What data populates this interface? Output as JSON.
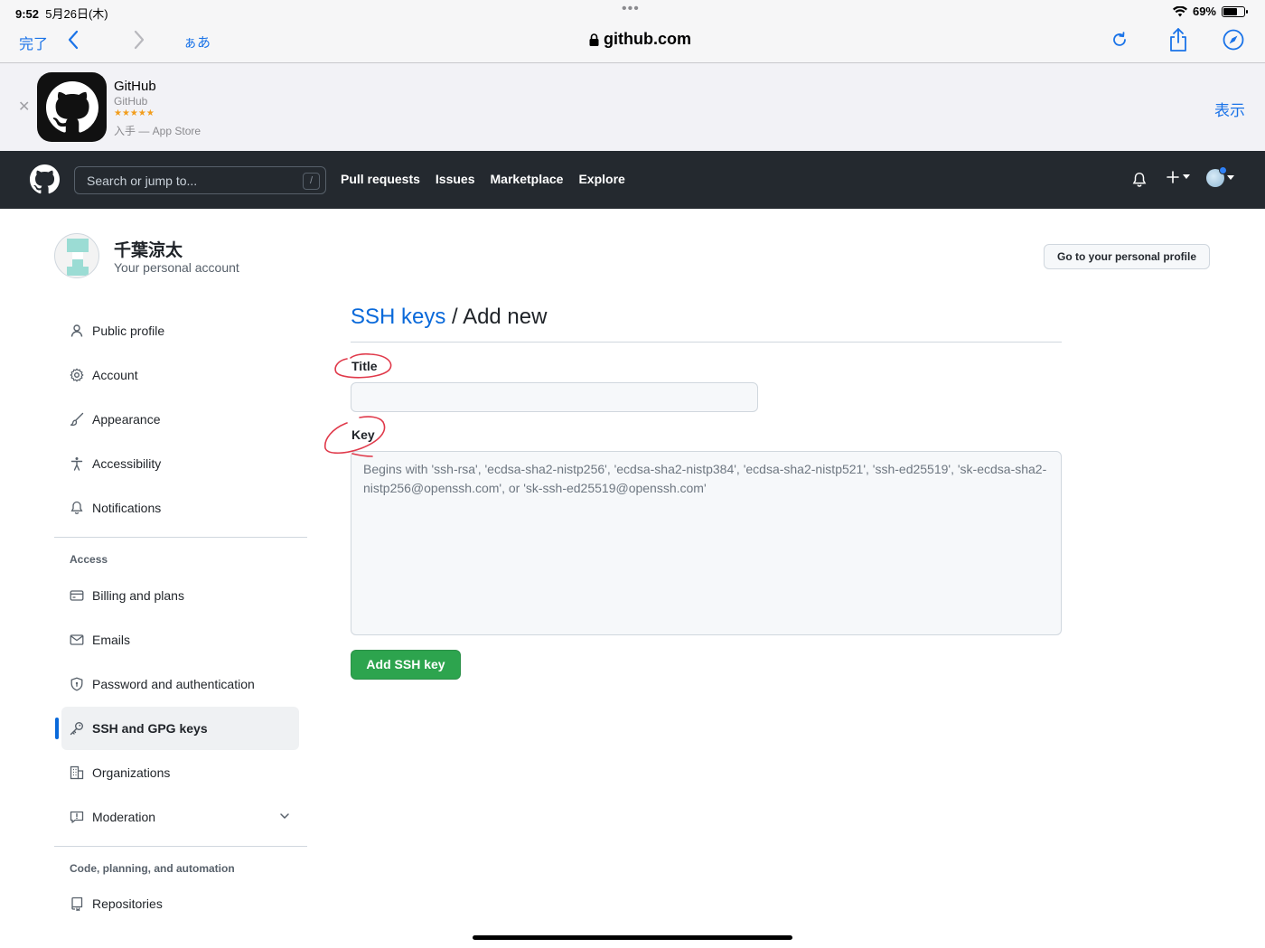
{
  "status_bar": {
    "time": "9:52",
    "date": "5月26日(木)",
    "battery": "69%",
    "battery_level": 0.69
  },
  "safari": {
    "done": "完了",
    "aa": "ぁあ",
    "url": "github.com"
  },
  "app_banner": {
    "name": "GitHub",
    "developer": "GitHub",
    "rating_stars": "★★★★★",
    "store_text": "入手 — App Store",
    "view": "表示"
  },
  "gh_header": {
    "search_placeholder": "Search or jump to...",
    "slash": "/",
    "nav": [
      "Pull requests",
      "Issues",
      "Marketplace",
      "Explore"
    ]
  },
  "profile": {
    "name": "千葉涼太",
    "subtitle": "Your personal account",
    "profile_button": "Go to your personal profile"
  },
  "sidebar": {
    "items_top": [
      {
        "label": "Public profile",
        "icon": "person-icon"
      },
      {
        "label": "Account",
        "icon": "gear-icon"
      },
      {
        "label": "Appearance",
        "icon": "paintbrush-icon"
      },
      {
        "label": "Accessibility",
        "icon": "accessibility-icon"
      },
      {
        "label": "Notifications",
        "icon": "bell-icon"
      }
    ],
    "access_heading": "Access",
    "items_access": [
      {
        "label": "Billing and plans",
        "icon": "credit-card-icon"
      },
      {
        "label": "Emails",
        "icon": "mail-icon"
      },
      {
        "label": "Password and authentication",
        "icon": "shield-lock-icon"
      },
      {
        "label": "SSH and GPG keys",
        "icon": "key-icon",
        "selected": true
      },
      {
        "label": "Organizations",
        "icon": "organization-icon"
      },
      {
        "label": "Moderation",
        "icon": "report-icon"
      }
    ],
    "code_heading": "Code, planning, and automation",
    "items_code": [
      {
        "label": "Repositories",
        "icon": "repo-icon"
      }
    ]
  },
  "main": {
    "breadcrumb_link": "SSH keys",
    "breadcrumb_sep": " / ",
    "breadcrumb_current": "Add new",
    "title_label": "Title",
    "title_value": "",
    "key_label": "Key",
    "key_placeholder": "Begins with 'ssh-rsa', 'ecdsa-sha2-nistp256', 'ecdsa-sha2-nistp384', 'ecdsa-sha2-nistp521', 'ssh-ed25519', 'sk-ecdsa-sha2-nistp256@openssh.com', or 'sk-ssh-ed25519@openssh.com'",
    "submit": "Add SSH key"
  },
  "colors": {
    "header_bg": "#24292f",
    "link": "#0969da",
    "primary_button": "#2da44e",
    "safari_accent": "#1a73e8",
    "annotation": "#e0394a"
  }
}
